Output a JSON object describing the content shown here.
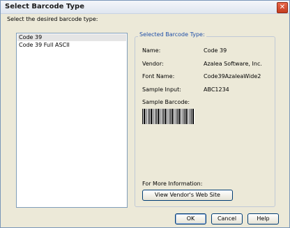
{
  "window": {
    "title": "Select Barcode Type",
    "close_glyph": "✕"
  },
  "prompt": "Select the desired barcode type:",
  "barcode_list": [
    {
      "label": "Code 39",
      "selected": true
    },
    {
      "label": "Code 39 Full ASCII",
      "selected": false
    }
  ],
  "details": {
    "caption": "Selected Barcode Type:",
    "name_label": "Name:",
    "name_value": "Code 39",
    "vendor_label": "Vendor:",
    "vendor_value": "Azalea Software, Inc.",
    "font_label": "Font Name:",
    "font_value": "Code39AzaleaWide2",
    "sample_input_label": "Sample Input:",
    "sample_input_value": "ABC1234",
    "sample_barcode_label": "Sample Barcode:",
    "more_info_label": "For More Information:",
    "vendor_button": "View Vendor's Web Site"
  },
  "buttons": {
    "ok": "OK",
    "cancel": "Cancel",
    "help": "Help"
  }
}
